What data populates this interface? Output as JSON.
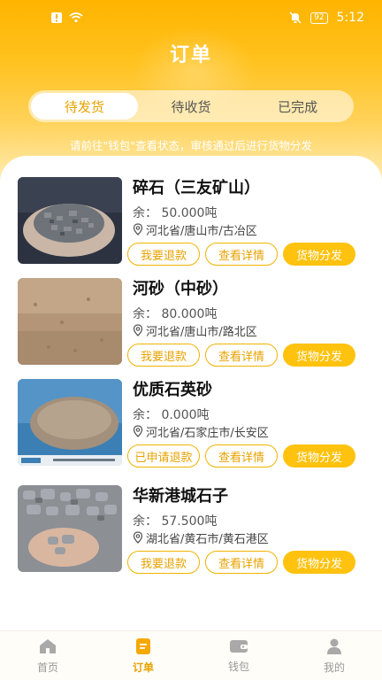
{
  "status_bar": {
    "time": "5:12",
    "battery": "92"
  },
  "page": {
    "title": "订单"
  },
  "tabs": [
    {
      "label": "待发货",
      "active": true
    },
    {
      "label": "待收货",
      "active": false
    },
    {
      "label": "已完成",
      "active": false
    }
  ],
  "notice": "请前往\"钱包\"查看状态，审核通过后进行货物分发",
  "orders": [
    {
      "name": "碎石（三友矿山）",
      "qty_label": "余：",
      "qty": "50.000吨",
      "location": "河北省/唐山市/古冶区",
      "btn1": "我要退款",
      "btn2": "查看详情",
      "btn3": "货物分发"
    },
    {
      "name": "河砂（中砂）",
      "qty_label": "余：",
      "qty": "80.000吨",
      "location": "河北省/唐山市/路北区",
      "btn1": "我要退款",
      "btn2": "查看详情",
      "btn3": "货物分发"
    },
    {
      "name": "优质石英砂",
      "qty_label": "余：",
      "qty": "0.000吨",
      "location": "河北省/石家庄市/长安区",
      "btn1": "已申请退款",
      "btn2": "查看详情",
      "btn3": "货物分发"
    },
    {
      "name": "华新港城石子",
      "qty_label": "余：",
      "qty": "57.500吨",
      "location": "湖北省/黄石市/黄石港区",
      "btn1": "我要退款",
      "btn2": "查看详情",
      "btn3": "货物分发"
    }
  ],
  "nav": [
    {
      "label": "首页",
      "icon": "home-icon",
      "active": false
    },
    {
      "label": "订单",
      "icon": "order-icon",
      "active": true
    },
    {
      "label": "钱包",
      "icon": "wallet-icon",
      "active": false
    },
    {
      "label": "我的",
      "icon": "user-icon",
      "active": false
    }
  ],
  "colors": {
    "accent": "#ffc20e",
    "accent_text": "#e8a200"
  }
}
